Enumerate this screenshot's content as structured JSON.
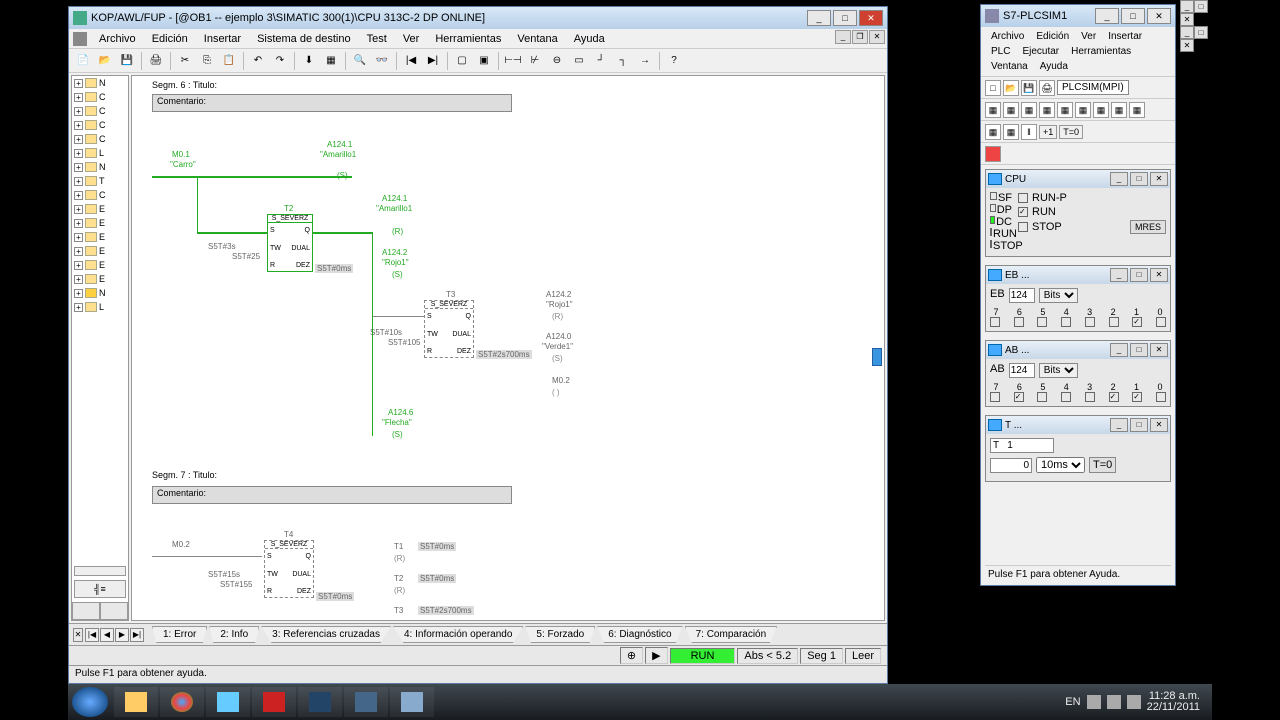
{
  "main": {
    "title": "KOP/AWL/FUP  - [@OB1 -- ejemplo 3\\SIMATIC 300(1)\\CPU 313C-2 DP  ONLINE]",
    "menu": [
      "Archivo",
      "Edición",
      "Insertar",
      "Sistema de destino",
      "Test",
      "Ver",
      "Herramientas",
      "Ventana",
      "Ayuda"
    ],
    "tree_items": [
      "N",
      "C",
      "C",
      "C",
      "C",
      "L",
      "N",
      "T",
      "C",
      "E",
      "E",
      "E",
      "E",
      "E",
      "E",
      "N",
      "L"
    ],
    "seg6": "Segm. 6 : Titulo:",
    "seg7": "Segm. 7 : Titulo:",
    "comentario": "Comentario:",
    "labels": {
      "m01": "M0.1",
      "carro": "\"Carro\"",
      "a1241": "A124.1",
      "amarillo1": "\"Amarillo1",
      "t2": "T2",
      "severz": "S_SEVERZ",
      "s5t3s": "S5T#3s",
      "s5t25": "S5T#25",
      "dual": "DUAL",
      "dez": "DEZ",
      "s5t0ms": "S5T#0ms",
      "a1242": "A124.2",
      "rojo1": "\"Rojo1\"",
      "t3": "T3",
      "s5t10s": "S5T#10s",
      "s5t105": "S5T#105",
      "s5t2s700": "S5T#2s700ms",
      "a1240": "A124.0",
      "verde1": "\"Verde1\"",
      "m02": "M0.2",
      "a1246": "A124.6",
      "flecha": "\"Flecha\"",
      "t4": "T4",
      "s5t15s": "S5T#15s",
      "s5t155": "S5T#155",
      "t1": "T1"
    },
    "tabs": [
      "1: Error",
      "2: Info",
      "3: Referencias cruzadas",
      "4: Información operando",
      "5: Forzado",
      "6: Diagnóstico",
      "7: Comparación"
    ],
    "status": {
      "run": "RUN",
      "abs": "Abs < 5.2",
      "seg": "Seg 1",
      "leer": "Leer"
    },
    "help": "Pulse F1 para obtener ayuda."
  },
  "sim": {
    "title": "S7-PLCSIM1",
    "menu": [
      "Archivo",
      "Edición",
      "Ver",
      "Insertar",
      "PLC",
      "Ejecutar",
      "Herramientas",
      "Ventana",
      "Ayuda"
    ],
    "combo": "PLCSIM(MPI)",
    "plus1": "+1",
    "t0": "T=0",
    "cpu": {
      "title": "CPU",
      "leds": [
        "SF",
        "DP",
        "DC",
        "RUN",
        "STOP"
      ],
      "opts": {
        "runp": "RUN-P",
        "run": "RUN",
        "stop": "STOP"
      },
      "mres": "MRES"
    },
    "eb": {
      "title": "EB ...",
      "prefix": "EB",
      "addr": "124",
      "fmt": "Bits",
      "bits": [
        "7",
        "6",
        "5",
        "4",
        "3",
        "2",
        "1",
        "0"
      ],
      "checked": [
        false,
        false,
        false,
        false,
        false,
        false,
        true,
        false
      ]
    },
    "ab": {
      "title": "AB ...",
      "prefix": "AB",
      "addr": "124",
      "fmt": "Bits",
      "bits": [
        "7",
        "6",
        "5",
        "4",
        "3",
        "2",
        "1",
        "0"
      ],
      "checked": [
        false,
        true,
        false,
        false,
        false,
        true,
        true,
        false
      ]
    },
    "t": {
      "title": "T ...",
      "name": "T   1",
      "val": "0",
      "base": "10ms",
      "t0": "T=0"
    },
    "help": "Pulse F1 para obtener Ayuda."
  },
  "taskbar": {
    "lang": "EN",
    "time": "11:28 a.m.",
    "date": "22/11/2011"
  }
}
